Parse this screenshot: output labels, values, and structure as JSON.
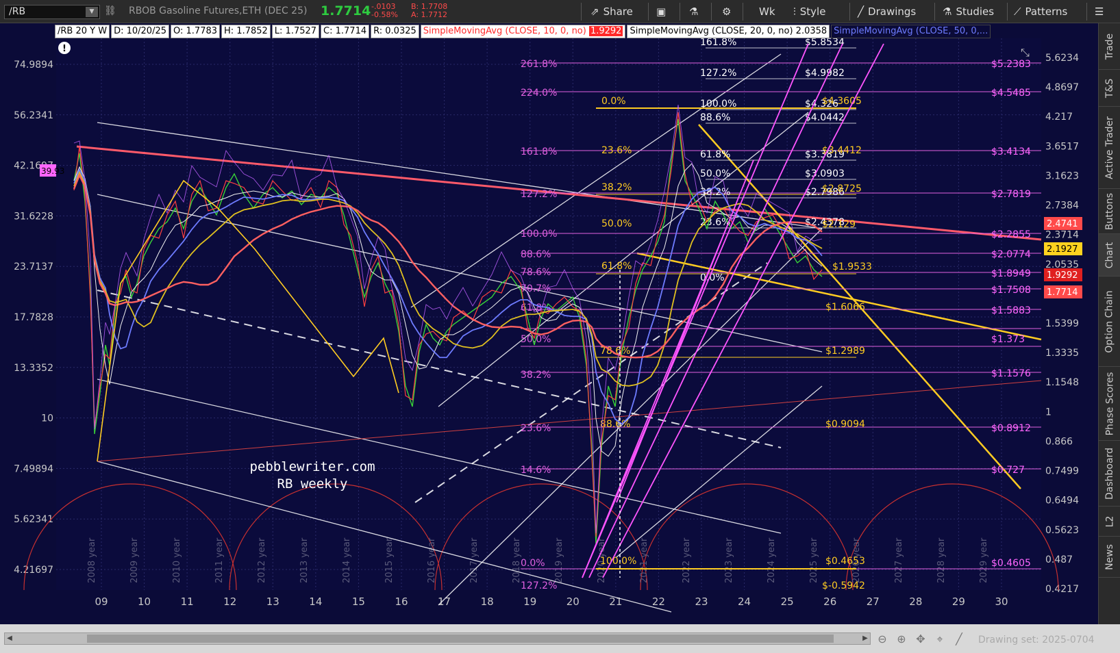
{
  "toolbar": {
    "symbol": "/RB",
    "description": "RBOB Gasoline Futures,ETH (DEC 25)",
    "last": "1.7714",
    "change": "-.0103",
    "change_pct": "-0.58%",
    "bid": "B: 1.7708",
    "ask": "A: 1.7712",
    "share": "Share",
    "timeframe": "Wk",
    "style": "Style",
    "drawings": "Drawings",
    "studies": "Studies",
    "patterns": "Patterns"
  },
  "legend": {
    "bar_info": "/RB 20 Y W",
    "date": "D: 10/20/25",
    "open": "O: 1.7783",
    "high": "H: 1.7852",
    "low": "L: 1.7527",
    "close": "C: 1.7714",
    "range": "R: 0.0325",
    "sma10": "SimpleMovingAvg (CLOSE, 10, 0, no)",
    "sma10_val": "1.9292",
    "sma20": "SimpleMovingAvg (CLOSE, 20, 0, no)",
    "sma20_val": "2.0358",
    "sma50": "SimpleMovingAvg (CLOSE, 50, 0,..."
  },
  "side_tabs": [
    "Trade",
    "T&S",
    "Active Trader",
    "Buttons",
    "Chart",
    "Option Chain",
    "Phase Scores",
    "Dashboard",
    "L2",
    "News"
  ],
  "active_side_tab": "Chart",
  "chart_data": {
    "type": "line",
    "left_axis_ticks": [
      "74.9894",
      "56.2341",
      "42.1697",
      "31.6228",
      "23.7137",
      "17.7828",
      "13.3352",
      "10",
      "7.49894",
      "5.62341",
      "4.21697"
    ],
    "left_axis_marker": "39.93",
    "right_axis_ticks": [
      "5.6234",
      "4.8697",
      "4.217",
      "3.6517",
      "3.1623",
      "2.7384",
      "2.3714",
      "2.0535",
      "1.7783",
      "1.5399",
      "1.3335",
      "1.1548",
      "1",
      "0.866",
      "0.7499",
      "0.6494",
      "0.5623",
      "0.487",
      "0.4217"
    ],
    "right_axis_markers": [
      {
        "label": "2.4741",
        "color": "#ff4a4a"
      },
      {
        "label": "2.1927",
        "color": "#ffd21f"
      },
      {
        "label": "1.9292",
        "color": "#e02020"
      },
      {
        "label": "1.7714",
        "color": "#ff4a4a"
      }
    ],
    "x_ticks": [
      "09",
      "10",
      "11",
      "12",
      "13",
      "14",
      "15",
      "16",
      "17",
      "18",
      "19",
      "20",
      "21",
      "22",
      "23",
      "24",
      "25",
      "26",
      "27",
      "28",
      "29",
      "30"
    ],
    "cycle_labels": [
      "2008 year",
      "2009 year",
      "2010 year",
      "2011 year",
      "2012 year",
      "2013 year",
      "2014 year",
      "2015 year",
      "2016 year",
      "2017 year",
      "2018 year",
      "2019 year",
      "2020 year",
      "2021 year",
      "2022 year",
      "2023 year",
      "2024 year",
      "2025 year",
      "2026 year",
      "2027 year",
      "2028 year",
      "2029 year"
    ],
    "fib_left": [
      "261.8%",
      "224.0%",
      "161.8%",
      "127.2%",
      "100.0%",
      "88.6%",
      "78.6%",
      "70.7%",
      "61.8%",
      "50.0%",
      "38.2%",
      "23.6%",
      "14.6%",
      "0.0%",
      "127.2%"
    ],
    "fib_mid": [
      "0.0%",
      "23.6%",
      "38.2%",
      "50.0%",
      "61.8%",
      "78.6%",
      "88.6%",
      "100.0%"
    ],
    "fib_top": [
      "161.8%",
      "127.2%",
      "100.0%",
      "88.6%",
      "61.8%",
      "50.0%",
      "38.2%",
      "23.6%",
      "0.0%"
    ],
    "price_labels_white": [
      "$5.8534",
      "$4.9982",
      "$4.326",
      "$4.0442",
      "$3.3819",
      "$3.0903",
      "$2.7986",
      "$2.4378"
    ],
    "price_labels_yellow": [
      "$4.3605",
      "$3.4412",
      "$2.8725",
      "$2.129",
      "$1.9533",
      "$1.6066",
      "$1.2989",
      "$0.9094",
      "$0.4653",
      "$-0.5942"
    ],
    "price_labels_magenta": [
      "$5.2383",
      "$4.5485",
      "$3.4134",
      "$2.7819",
      "$2.2855",
      "$2.0774",
      "$1.8949",
      "$1.7508",
      "$1.5883",
      "$1.373",
      "$1.1576",
      "$0.8912",
      "$0.727",
      "$0.4605"
    ],
    "annotation_1": "pebblewriter.com",
    "annotation_2": "RB weekly",
    "grid": true
  },
  "bottom": {
    "drawing_set": "Drawing set: 2025-0704"
  }
}
